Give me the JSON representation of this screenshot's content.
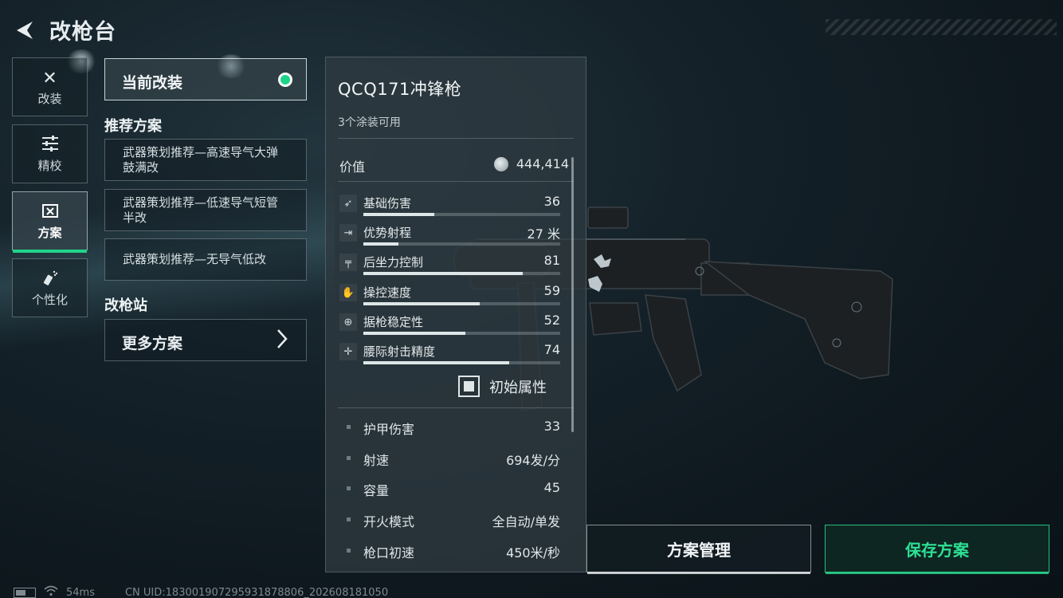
{
  "header": {
    "title": "改枪台"
  },
  "side_tabs": [
    {
      "label": "改装",
      "icon": "wrench-screwdriver-icon"
    },
    {
      "label": "精校",
      "icon": "sliders-icon"
    },
    {
      "label": "方案",
      "icon": "blueprint-icon",
      "active": true
    },
    {
      "label": "个性化",
      "icon": "spray-can-icon"
    }
  ],
  "middle": {
    "current_label": "当前改装",
    "recommend_title": "推荐方案",
    "presets": [
      "武器策划推荐—高速导气大弹鼓满改",
      "武器策划推荐—低速导气短管半改",
      "武器策划推荐—无导气低改"
    ],
    "station_title": "改枪站",
    "more_label": "更多方案"
  },
  "weapon": {
    "name": "QCQ171冲锋枪",
    "skins": "3个涂装可用",
    "value_label": "价值",
    "value": "444,414",
    "stats": [
      {
        "name": "基础伤害",
        "value": "36",
        "level": 0.36,
        "icon": "damage-icon"
      },
      {
        "name": "优势射程",
        "value": "27 米",
        "level": 0.18,
        "icon": "range-icon"
      },
      {
        "name": "后坐力控制",
        "value": "81",
        "level": 0.81,
        "icon": "recoil-icon"
      },
      {
        "name": "操控速度",
        "value": "59",
        "level": 0.59,
        "icon": "handling-icon"
      },
      {
        "name": "据枪稳定性",
        "value": "52",
        "level": 0.52,
        "icon": "stability-icon"
      },
      {
        "name": "腰际射击精度",
        "value": "74",
        "level": 0.74,
        "icon": "hipfire-icon"
      }
    ],
    "base_attr_label": "初始属性",
    "attributes": [
      {
        "name": "护甲伤害",
        "value": "33"
      },
      {
        "name": "射速",
        "value": "694发/分"
      },
      {
        "name": "容量",
        "value": "45"
      },
      {
        "name": "开火模式",
        "value": "全自动/单发"
      },
      {
        "name": "枪口初速",
        "value": "450米/秒"
      }
    ]
  },
  "actions": {
    "manage": "方案管理",
    "save": "保存方案"
  },
  "status": {
    "ping": "54ms",
    "uid": "CN UID:18300190729593187880​6_202608181050"
  },
  "colors": {
    "accent": "#21d38a",
    "panel": "#2e3a40"
  }
}
